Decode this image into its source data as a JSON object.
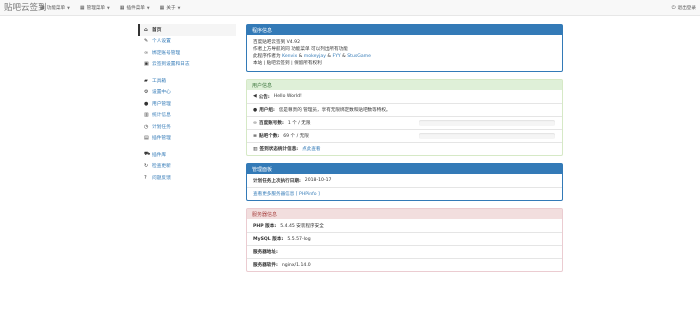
{
  "navbar": {
    "brand": "贴吧云签到",
    "menu": [
      {
        "icon": "grid-icon",
        "label": "功能菜单"
      },
      {
        "icon": "grid-icon",
        "label": "管理菜单"
      },
      {
        "icon": "grid-icon",
        "label": "插件菜单"
      },
      {
        "icon": "grid-icon",
        "label": "关于"
      }
    ],
    "logout": "退出登录"
  },
  "sidebar": {
    "group1": [
      {
        "icon": "home-icon",
        "label": "首页",
        "active": true
      },
      {
        "icon": "wrench-icon",
        "label": "个人设置"
      },
      {
        "icon": "link-icon",
        "label": "绑定账号管理"
      },
      {
        "icon": "calendar-icon",
        "label": "云签到设置和日志"
      }
    ],
    "group2": [
      {
        "icon": "briefcase-icon",
        "label": "工具箱"
      },
      {
        "icon": "cog-icon",
        "label": "设置中心"
      },
      {
        "icon": "user-icon",
        "label": "用户管理"
      },
      {
        "icon": "stats-icon",
        "label": "统计信息"
      },
      {
        "icon": "clock-icon",
        "label": "计划任务"
      },
      {
        "icon": "plugin-icon",
        "label": "插件管理"
      }
    ],
    "group3": [
      {
        "icon": "cart-icon",
        "label": "插件库"
      },
      {
        "icon": "refresh-icon",
        "label": "检查更新"
      },
      {
        "icon": "question-icon",
        "label": "问题反馈"
      }
    ]
  },
  "panels": {
    "program_info": {
      "title": "程序信息",
      "line1": "百度贴吧云签到 V4.92",
      "line2": "作者上方导航的同 功能菜单 可以列出所有功能",
      "line3_prefix": "此程序作者为 ",
      "author1": "Kenvix",
      "amp1": " & ",
      "author2": "mokeyjay",
      "amp2": " & ",
      "author3": "FYY",
      "amp3": " & ",
      "author4": "StusGame",
      "line4": "本站 | 贴吧云签到 | 保留所有权利"
    },
    "user_info": {
      "title": "用户信息",
      "announcement_label": "公告:",
      "announcement_value": "Hello World!",
      "user_label": "用户组:",
      "user_value": "您是尊贵的 管理员，享有无限绑定数和贴吧数等特权。",
      "bind_label": "百度账号数:",
      "bind_value": "1 个 / 无限",
      "bind_progress": 0,
      "tieba_label": "贴吧个数:",
      "tieba_value": "69 个 / 无限",
      "tieba_progress": 0,
      "status_label": "签到状态统计信息:",
      "status_link": "点此查看"
    },
    "admin": {
      "title": "管理面板",
      "cron_label": "计划任务上次执行日期:",
      "cron_value": "2018-10-17",
      "phpinfo_link": "查看更多服务器信息 [ PHPinfo ]"
    },
    "server": {
      "title": "服务器信息",
      "php_label": "PHP 版本:",
      "php_value": "5.4.45 安装程序安全",
      "mysql_label": "MySQL 版本:",
      "mysql_value": "5.5.57-log",
      "address_label": "服务器地址:",
      "address_value": "",
      "software_label": "服务器软件:",
      "software_value": "nginx/1.14.0"
    }
  },
  "colors": {
    "primary": "#337ab7",
    "success_bg": "#dff0d8",
    "danger_bg": "#f2dede"
  }
}
